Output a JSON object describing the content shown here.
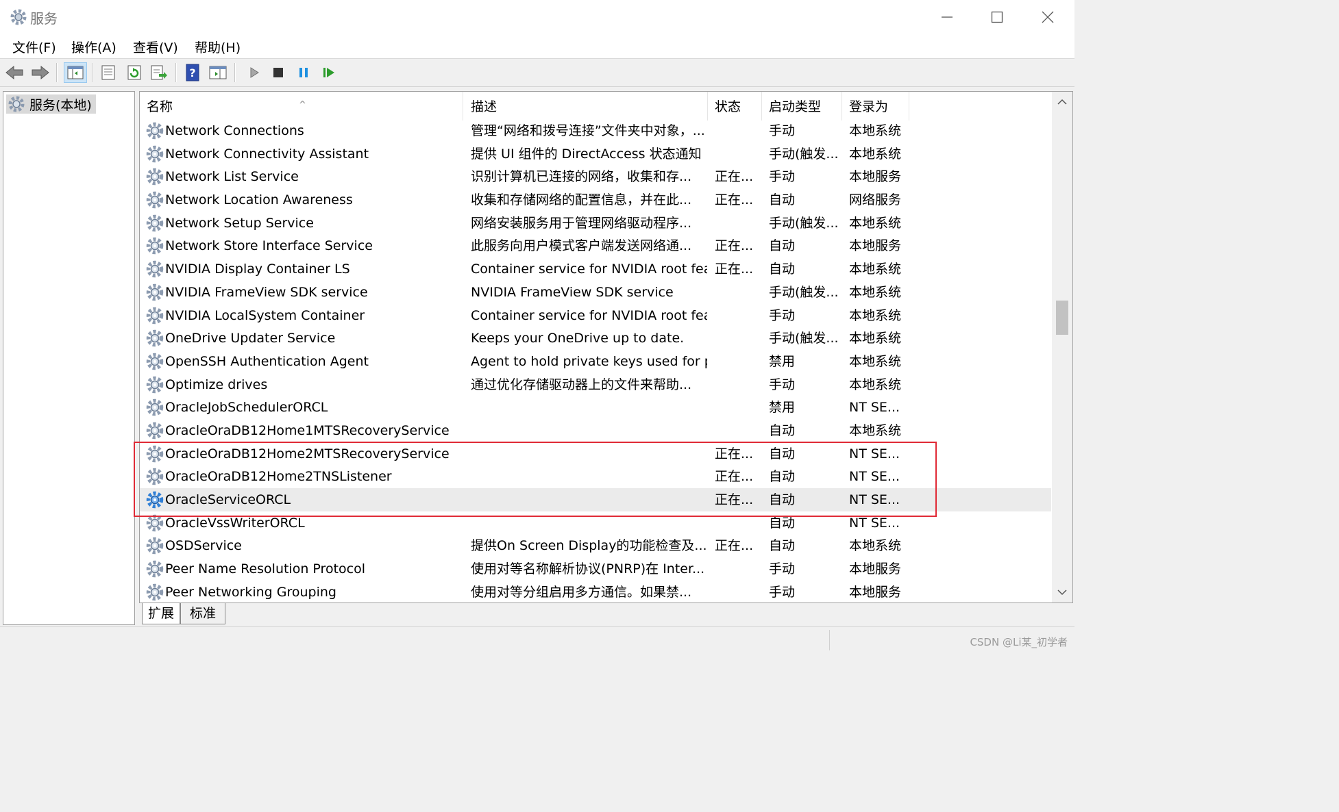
{
  "window": {
    "title": "服务"
  },
  "menu": [
    "文件(F)",
    "操作(A)",
    "查看(V)",
    "帮助(H)"
  ],
  "tree": {
    "root_label": "服务(本地)"
  },
  "columns": [
    "名称",
    "描述",
    "状态",
    "启动类型",
    "登录为"
  ],
  "rows": [
    {
      "name": "Network Connections",
      "desc": "管理“网络和拨号连接”文件夹中对象，...",
      "status": "",
      "start": "手动",
      "logon": "本地系统"
    },
    {
      "name": "Network Connectivity Assistant",
      "desc": "提供 UI 组件的 DirectAccess 状态通知",
      "status": "",
      "start": "手动(触发...",
      "logon": "本地系统"
    },
    {
      "name": "Network List Service",
      "desc": "识别计算机已连接的网络，收集和存...",
      "status": "正在...",
      "start": "手动",
      "logon": "本地服务"
    },
    {
      "name": "Network Location Awareness",
      "desc": "收集和存储网络的配置信息，并在此...",
      "status": "正在...",
      "start": "自动",
      "logon": "网络服务"
    },
    {
      "name": "Network Setup Service",
      "desc": "网络安装服务用于管理网络驱动程序...",
      "status": "",
      "start": "手动(触发...",
      "logon": "本地系统"
    },
    {
      "name": "Network Store Interface Service",
      "desc": "此服务向用户模式客户端发送网络通...",
      "status": "正在...",
      "start": "自动",
      "logon": "本地服务"
    },
    {
      "name": "NVIDIA Display Container LS",
      "desc": "Container service for NVIDIA root fea...",
      "status": "正在...",
      "start": "自动",
      "logon": "本地系统"
    },
    {
      "name": "NVIDIA FrameView SDK service",
      "desc": "NVIDIA FrameView SDK service",
      "status": "",
      "start": "手动(触发...",
      "logon": "本地系统"
    },
    {
      "name": "NVIDIA LocalSystem Container",
      "desc": "Container service for NVIDIA root fea...",
      "status": "",
      "start": "手动",
      "logon": "本地系统"
    },
    {
      "name": "OneDrive Updater Service",
      "desc": "Keeps your OneDrive up to date.",
      "status": "",
      "start": "手动(触发...",
      "logon": "本地系统"
    },
    {
      "name": "OpenSSH Authentication Agent",
      "desc": "Agent to hold private keys used for p...",
      "status": "",
      "start": "禁用",
      "logon": "本地系统"
    },
    {
      "name": "Optimize drives",
      "desc": "通过优化存储驱动器上的文件来帮助...",
      "status": "",
      "start": "手动",
      "logon": "本地系统"
    },
    {
      "name": "OracleJobSchedulerORCL",
      "desc": "",
      "status": "",
      "start": "禁用",
      "logon": "NT SE..."
    },
    {
      "name": "OracleOraDB12Home1MTSRecoveryService",
      "desc": "",
      "status": "",
      "start": "自动",
      "logon": "本地系统"
    },
    {
      "name": "OracleOraDB12Home2MTSRecoveryService",
      "desc": "",
      "status": "正在...",
      "start": "自动",
      "logon": "NT SE..."
    },
    {
      "name": "OracleOraDB12Home2TNSListener",
      "desc": "",
      "status": "正在...",
      "start": "自动",
      "logon": "NT SE..."
    },
    {
      "name": "OracleServiceORCL",
      "desc": "",
      "status": "正在...",
      "start": "自动",
      "logon": "NT SE...",
      "highlighted": true
    },
    {
      "name": "OracleVssWriterORCL",
      "desc": "",
      "status": "",
      "start": "自动",
      "logon": "NT SE..."
    },
    {
      "name": "OSDService",
      "desc": "提供On Screen Display的功能检查及...",
      "status": "正在...",
      "start": "自动",
      "logon": "本地系统"
    },
    {
      "name": "Peer Name Resolution Protocol",
      "desc": "使用对等名称解析协议(PNRP)在 Inter...",
      "status": "",
      "start": "手动",
      "logon": "本地服务"
    },
    {
      "name": "Peer Networking Grouping",
      "desc": "使用对等分组启用多方通信。如果禁...",
      "status": "",
      "start": "手动",
      "logon": "本地服务"
    }
  ],
  "tabs": [
    "扩展",
    "标准"
  ],
  "watermark": "CSDN @Li某_初学者",
  "colors": {
    "annotation_box": "#e02a36",
    "gear_blue": "#2f7fd6",
    "gear_gray": "#8c9bb0"
  }
}
